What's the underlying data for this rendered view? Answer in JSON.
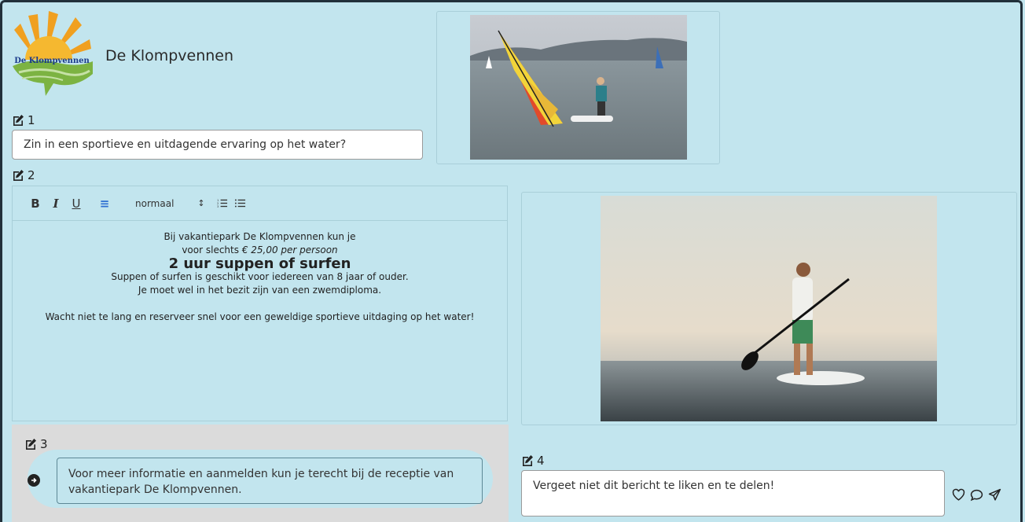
{
  "site": {
    "name": "De Klompvennen",
    "logo_text": "De Klompvennen"
  },
  "field1": {
    "label": "1",
    "value": "Zin in een sportieve en uitdagende ervaring op het water?"
  },
  "field2": {
    "label": "2",
    "toolbar": {
      "bold": "B",
      "italic": "I",
      "underline": "U",
      "align": "≡",
      "size": "normaal",
      "size_arrow": "↕"
    },
    "line1": "Bij vakantiepark De Klompvennen kun je",
    "line2_prefix": "voor slechts ",
    "line2_price": "€ 25,00 per persoon",
    "heading": "2 uur suppen of surfen",
    "para2_line1": "Suppen of surfen is geschikt voor iedereen van 8 jaar of ouder.",
    "para2_line2": "Je moet wel in het bezit zijn van een zwemdiploma.",
    "para3": "Wacht niet te lang en reserveer snel voor een geweldige sportieve uitdaging op het water!"
  },
  "field3": {
    "label": "3",
    "value": "Voor meer informatie en aanmelden kun je terecht bij de receptie van vakantiepark De Klompvennen."
  },
  "field4": {
    "label": "4",
    "value": "Vergeet niet dit bericht te liken en te delen!"
  },
  "icons": {
    "edit": "edit-icon",
    "heart": "heart-icon",
    "comment": "comment-icon",
    "share": "send-icon",
    "arrow": "arrow-right-circle-icon"
  }
}
